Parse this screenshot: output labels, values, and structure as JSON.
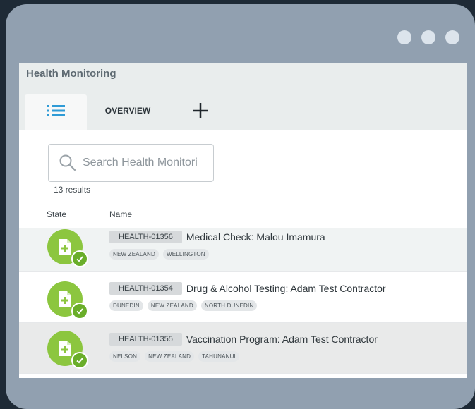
{
  "window": {
    "dots": [
      "dot",
      "dot",
      "dot"
    ]
  },
  "app": {
    "title": "Health Monitoring"
  },
  "tabs": [
    {
      "icon": "list-icon"
    },
    {
      "label": "OVERVIEW"
    },
    {
      "icon": "plus-icon"
    }
  ],
  "search": {
    "placeholder": "Search Health Monitori",
    "icon": "search-icon"
  },
  "results": "13 results",
  "table": {
    "headers": {
      "state": "State",
      "name": "Name"
    },
    "rows": [
      {
        "id": "HEALTH-01356",
        "title": "Medical Check: Malou Imamura",
        "tags": [
          "NEW ZEALAND",
          "WELLINGTON"
        ],
        "state_icon": "document-plus-check-icon",
        "highlighted": true
      },
      {
        "id": "HEALTH-01354",
        "title": "Drug & Alcohol Testing: Adam Test Contractor",
        "tags": [
          "DUNEDIN",
          "NEW ZEALAND",
          "NORTH DUNEDIN"
        ],
        "state_icon": "document-plus-check-icon",
        "highlighted": false
      },
      {
        "id": "HEALTH-01355",
        "title": "Vaccination Program: Adam Test Contractor",
        "tags": [
          "NELSON",
          "NEW ZEALAND",
          "TAHUNANUI"
        ],
        "state_icon": "document-plus-check-icon",
        "highlighted": true
      }
    ]
  },
  "colors": {
    "state_green": "#8cc63f",
    "check_green": "#6aae2a",
    "row_highlight": "#f0f3f3",
    "row_selected": "#e9eaea"
  }
}
